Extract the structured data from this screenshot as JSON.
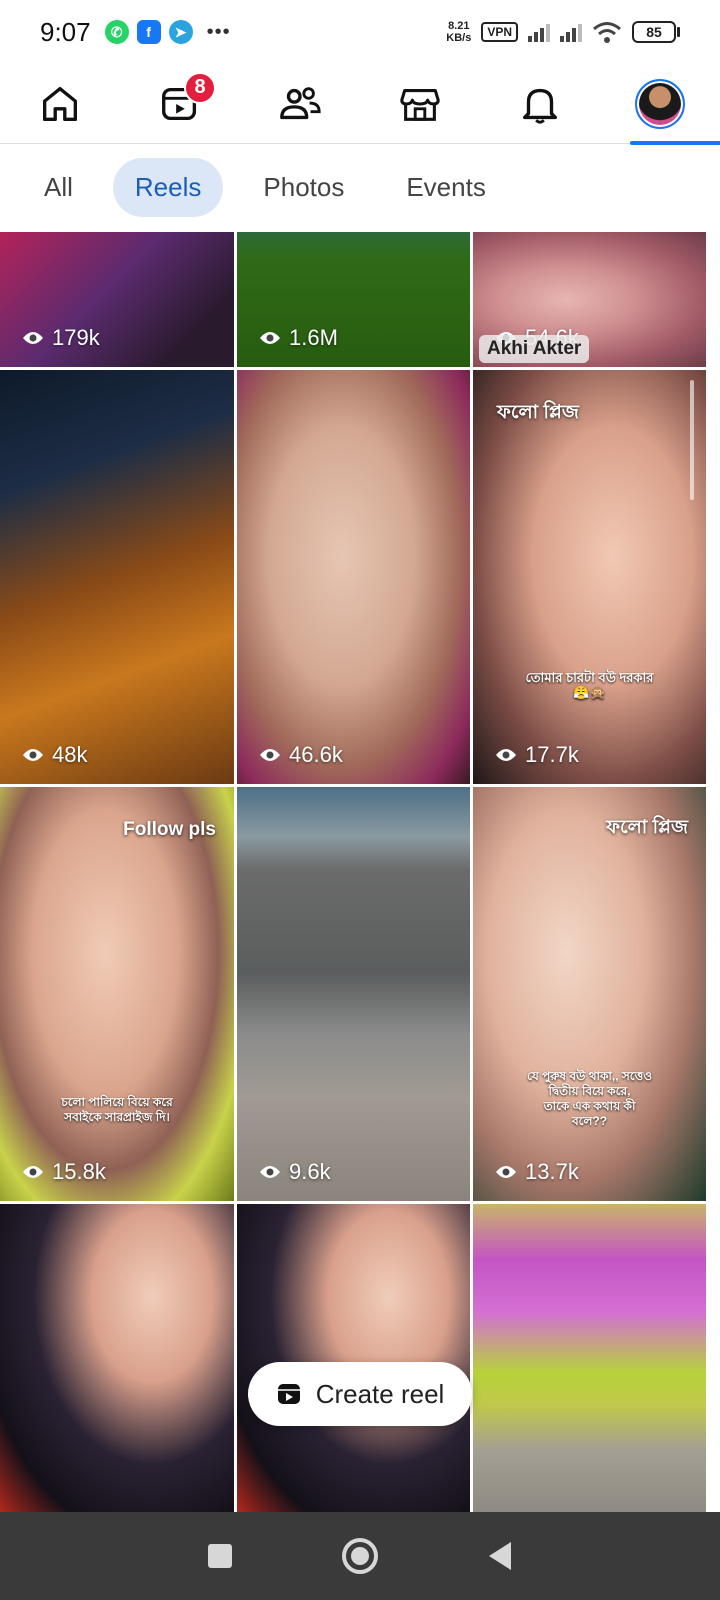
{
  "status_bar": {
    "time": "9:07",
    "apps": [
      "whatsapp-icon",
      "facebook-icon",
      "telegram-icon"
    ],
    "more": "•••",
    "net_speed_value": "8.21",
    "net_speed_unit": "KB/s",
    "vpn": "VPN",
    "battery": "85"
  },
  "nav": {
    "items": [
      "home-icon",
      "reels-icon",
      "friends-icon",
      "marketplace-icon",
      "notifications-icon",
      "profile-avatar"
    ],
    "reels_badge": "8",
    "active_index": 5
  },
  "filters": {
    "tabs": [
      {
        "label": "All",
        "active": false
      },
      {
        "label": "Reels",
        "active": true
      },
      {
        "label": "Photos",
        "active": false
      },
      {
        "label": "Events",
        "active": false
      }
    ]
  },
  "reels": [
    {
      "views": "179k"
    },
    {
      "views": "1.6M"
    },
    {
      "views": "54.6k",
      "name_tag": "Akhi Akter"
    },
    {
      "views": "48k"
    },
    {
      "views": "46.6k"
    },
    {
      "views": "17.7k",
      "top_text": "ফলো প্লিজ",
      "caption_line1": "তোমার চারটা বউ দরকার",
      "caption_line2": "😤🙊"
    },
    {
      "views": "15.8k",
      "top_text": "Follow pls",
      "caption_line1": "চলো পালিয়ে বিয়ে করে",
      "caption_line2": "সবাইকে সারপ্রাইজ দি।"
    },
    {
      "views": "9.6k"
    },
    {
      "views": "13.7k",
      "top_text": "ফলো প্লিজ",
      "caption_line1": "যে পুরুষ বউ থাকা,, সত্তেও",
      "caption_line2": "দ্বিতীয় বিয়ে করে,",
      "caption_line3": "তাকে এক কথায় কী",
      "caption_line4": "বলে??"
    },
    {},
    {},
    {}
  ],
  "create_reel": {
    "label": "Create reel"
  },
  "colors": {
    "accent": "#1877f2",
    "chip_active_bg": "#dbe7f6",
    "chip_active_text": "#1b5fb4",
    "badge": "#e41e3f",
    "sys_nav_bg": "#3a3a3a"
  }
}
